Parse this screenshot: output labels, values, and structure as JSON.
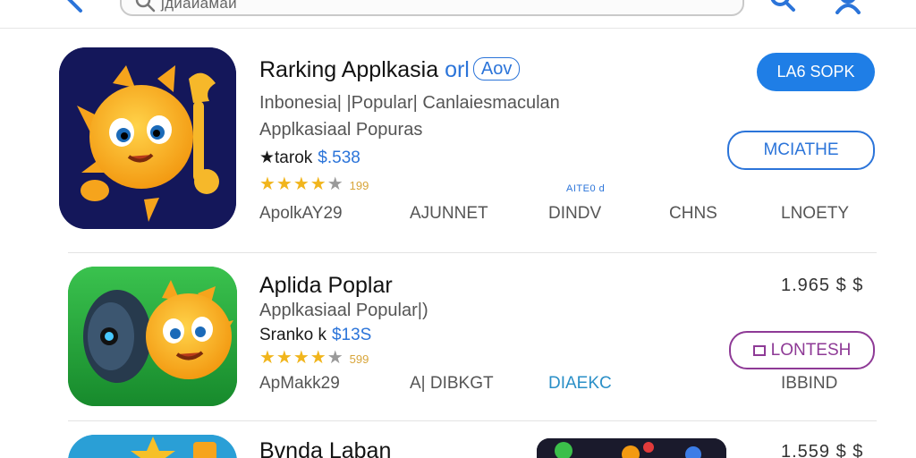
{
  "header": {
    "search_value": "јдиаиамаи",
    "icons": [
      "back-icon",
      "search-icon",
      "search-icon",
      "user-icon"
    ]
  },
  "apps": [
    {
      "title": "Rarking Applkasia",
      "title_suffix": "orl",
      "badge": "Aov",
      "subtitle_1": "Inbonesia| |Popular| Canlaiesmaculan",
      "subtitle_2": "Applkasiaal Popuras",
      "rank_label": "★tarok",
      "rank_price": "$.538",
      "rating": 4,
      "rating_count": "199",
      "button_primary": "LA6 SOPK",
      "button_secondary": "MCIATHE",
      "small_label": "AITE0 d",
      "meta": [
        "ApolkAY29",
        "AJUNNET",
        "DINDV",
        "CHNS",
        "LNOETY"
      ]
    },
    {
      "title": "Aplida Poplar",
      "subtitle_1": "Applkasiaal Popular|)",
      "rank_label": "Sranko k",
      "rank_price": "$13S",
      "rating": 4,
      "rating_count": "599",
      "price_right": "1.965 $ $",
      "button_secondary": "LONTESH",
      "meta": [
        "ApMakk29",
        "A| DIBKGT",
        "DIAEKC",
        "IBBIND"
      ]
    },
    {
      "title": "Bvnda Laban",
      "price_right": "1.559 $ $"
    }
  ],
  "colors": {
    "accent": "#1f7ee6",
    "outline_blue": "#2b74d9",
    "purple": "#8e3a96",
    "star": "#f1b51c",
    "icon1_bg": "#14175a",
    "icon2_bg": "#1fa23a"
  }
}
